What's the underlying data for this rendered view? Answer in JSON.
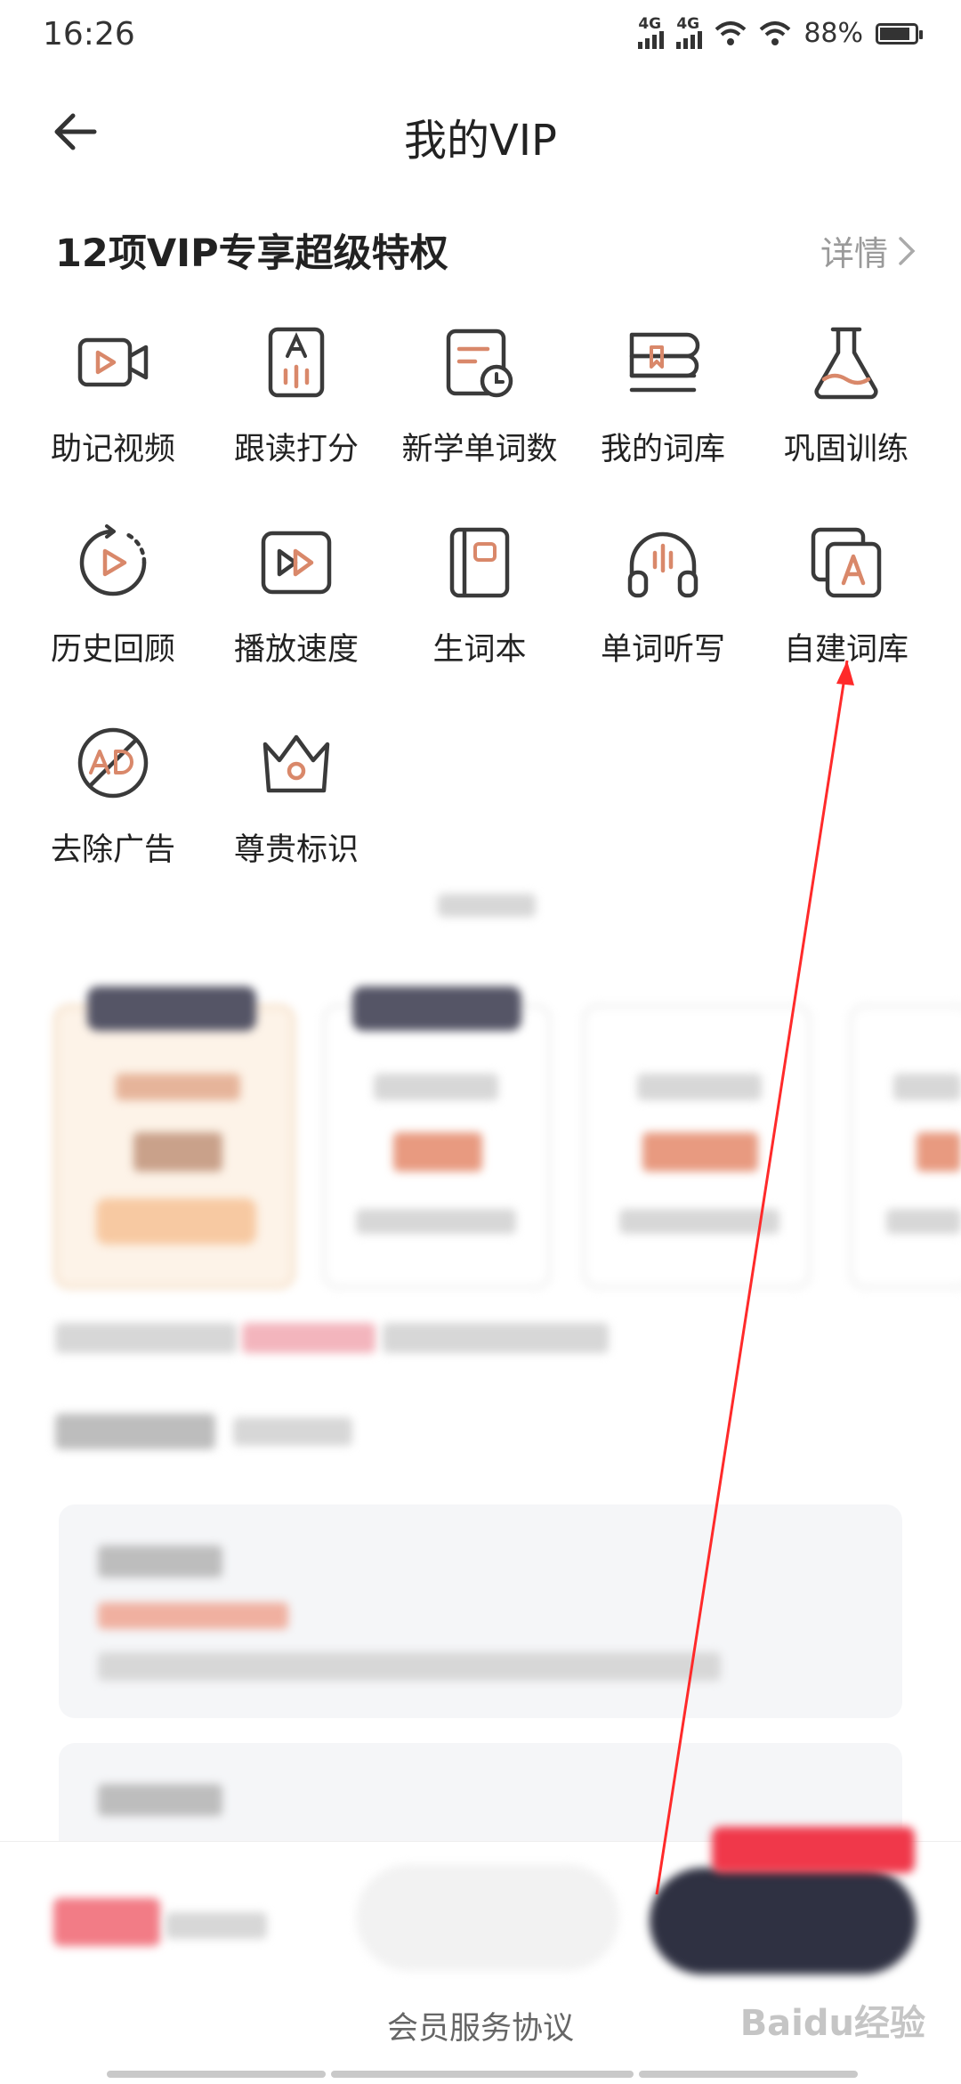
{
  "status": {
    "time": "16:26",
    "net1": "4G",
    "net2": "4G",
    "battery_pct": "88%",
    "battery_level": 0.88
  },
  "header": {
    "title": "我的VIP"
  },
  "section": {
    "title": "12项VIP专享超级特权",
    "detail_label": "详情"
  },
  "privileges": [
    {
      "label": "助记视频",
      "icon": "video-icon"
    },
    {
      "label": "跟读打分",
      "icon": "read-score-icon"
    },
    {
      "label": "新学单词数",
      "icon": "calendar-clock-icon"
    },
    {
      "label": "我的词库",
      "icon": "word-library-icon"
    },
    {
      "label": "巩固训练",
      "icon": "flask-icon"
    },
    {
      "label": "历史回顾",
      "icon": "history-icon"
    },
    {
      "label": "播放速度",
      "icon": "fast-forward-icon"
    },
    {
      "label": "生词本",
      "icon": "notebook-icon"
    },
    {
      "label": "单词听写",
      "icon": "headphones-icon"
    },
    {
      "label": "自建词库",
      "icon": "custom-library-icon"
    },
    {
      "label": "去除广告",
      "icon": "no-ad-icon"
    },
    {
      "label": "尊贵标识",
      "icon": "crown-icon"
    }
  ],
  "footer": {
    "agreement": "会员服务协议",
    "watermark": "Baidu经验"
  },
  "colors": {
    "accent": "#d9886a",
    "icon_stroke": "#3a3a3a",
    "annotation": "#ff2a2a"
  }
}
